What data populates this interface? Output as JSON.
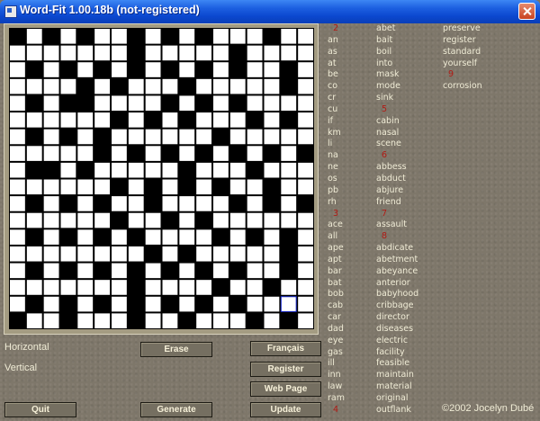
{
  "window": {
    "title": "Word-Fit 1.00.18b  (not-registered)"
  },
  "grid": {
    "cols": 18,
    "rows": 18,
    "rows_pattern": [
      "010101101010111011",
      "111111101111101111",
      "101010101010101101",
      "111101011101111101",
      "101001111010101111",
      "111111010101110101",
      "101010111111011111",
      "111110101010101010",
      "100101111101110111",
      "111111010101011011",
      "101010110111101010",
      "111111011010111111",
      "101010101111010101",
      "111111110101111101",
      "101010101010101101",
      "111111101111011011",
      "101010101010101111",
      "011011101101110101"
    ],
    "selected_cell": {
      "row": 16,
      "col": 16
    }
  },
  "panel": {
    "horizontal_label": "Horizontal",
    "vertical_label": "Vertical"
  },
  "buttons": {
    "erase": "Erase",
    "francais": "Français",
    "register": "Register",
    "web_page": "Web Page",
    "quit": "Quit",
    "generate": "Generate",
    "update": "Update"
  },
  "word_columns": [
    [
      {
        "t": "2",
        "n": true
      },
      {
        "t": "an"
      },
      {
        "t": "as"
      },
      {
        "t": "at"
      },
      {
        "t": "be"
      },
      {
        "t": "co"
      },
      {
        "t": "cr"
      },
      {
        "t": "cu"
      },
      {
        "t": "if"
      },
      {
        "t": "km"
      },
      {
        "t": "li"
      },
      {
        "t": "na"
      },
      {
        "t": "ne"
      },
      {
        "t": "os"
      },
      {
        "t": "pb"
      },
      {
        "t": "rh"
      },
      {
        "t": "3",
        "n": true
      },
      {
        "t": "ace"
      },
      {
        "t": "all"
      },
      {
        "t": "ape"
      },
      {
        "t": "apt"
      },
      {
        "t": "bar"
      },
      {
        "t": "bat"
      },
      {
        "t": "bob"
      },
      {
        "t": "cab"
      },
      {
        "t": "car"
      },
      {
        "t": "dad"
      },
      {
        "t": "eye"
      },
      {
        "t": "gas"
      },
      {
        "t": "ill"
      },
      {
        "t": "inn"
      },
      {
        "t": "law"
      },
      {
        "t": "ram"
      },
      {
        "t": "4",
        "n": true
      }
    ],
    [
      {
        "t": "abet"
      },
      {
        "t": "bait"
      },
      {
        "t": "boil"
      },
      {
        "t": "into"
      },
      {
        "t": "mask"
      },
      {
        "t": "mode"
      },
      {
        "t": "sink"
      },
      {
        "t": "5",
        "n": true
      },
      {
        "t": "cabin"
      },
      {
        "t": "nasal"
      },
      {
        "t": "scene"
      },
      {
        "t": "6",
        "n": true
      },
      {
        "t": "abbess"
      },
      {
        "t": "abduct"
      },
      {
        "t": "abjure"
      },
      {
        "t": "friend"
      },
      {
        "t": "7",
        "n": true
      },
      {
        "t": "assault"
      },
      {
        "t": "8",
        "n": true
      },
      {
        "t": "abdicate"
      },
      {
        "t": "abetment"
      },
      {
        "t": "abeyance"
      },
      {
        "t": "anterior"
      },
      {
        "t": "babyhood"
      },
      {
        "t": "cribbage"
      },
      {
        "t": "director"
      },
      {
        "t": "diseases"
      },
      {
        "t": "electric"
      },
      {
        "t": "facility"
      },
      {
        "t": "feasible"
      },
      {
        "t": "maintain"
      },
      {
        "t": "material"
      },
      {
        "t": "original"
      },
      {
        "t": "outflank"
      }
    ],
    [
      {
        "t": "preserve"
      },
      {
        "t": "register"
      },
      {
        "t": "standard"
      },
      {
        "t": "yourself"
      },
      {
        "t": "9",
        "n": true
      },
      {
        "t": "corrosion"
      }
    ]
  ],
  "copyright": "©2002 Jocelyn Dubé",
  "colors": {
    "titlebar": "#0b47cf",
    "background": "#7e776a",
    "number": "#b01a14"
  }
}
